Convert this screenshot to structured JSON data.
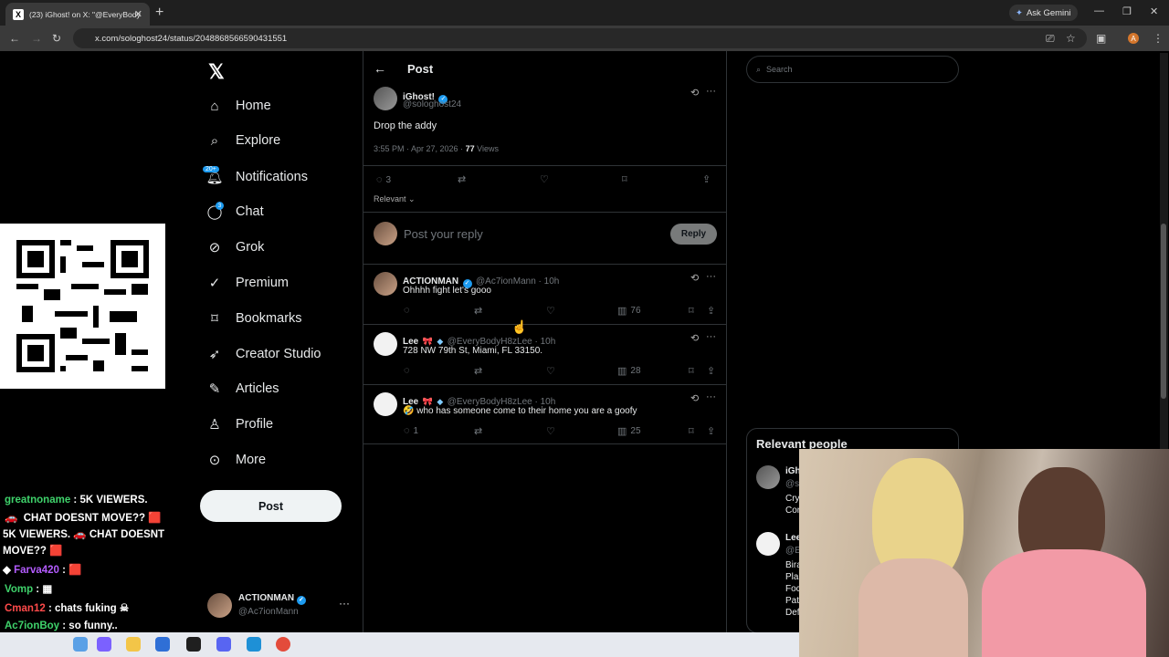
{
  "browser": {
    "tab_title": "(23) iGhost! on X: \"@EveryBody",
    "url": "x.com/sologhost24/status/2048868566590431551",
    "ask_gemini": "Ask Gemini",
    "profile_initial": "A"
  },
  "sidebar": {
    "items": [
      {
        "label": "Home",
        "icon": "home-icon"
      },
      {
        "label": "Explore",
        "icon": "search-icon"
      },
      {
        "label": "Notifications",
        "icon": "bell-icon"
      },
      {
        "label": "Chat",
        "icon": "chat-icon"
      },
      {
        "label": "Grok",
        "icon": "grok-icon"
      },
      {
        "label": "Premium",
        "icon": "premium-icon"
      },
      {
        "label": "Bookmarks",
        "icon": "bookmark-icon"
      },
      {
        "label": "Creator Studio",
        "icon": "rocket-icon"
      },
      {
        "label": "Articles",
        "icon": "articles-icon"
      },
      {
        "label": "Profile",
        "icon": "person-icon"
      },
      {
        "label": "More",
        "icon": "more-icon"
      }
    ],
    "notifications_badge": "20+",
    "chat_badge": "3",
    "post_button": "Post",
    "account": {
      "name": "ACTIONMAN",
      "handle": "@Ac7ionMann"
    }
  },
  "main": {
    "header_title": "Post",
    "post": {
      "author": "iGhost!",
      "handle": "@sologhost24",
      "text": "Drop the addy",
      "time": "3:55 PM · Apr 27, 2026 ·",
      "views_count": "77",
      "views_label": "Views",
      "reply_count": "3"
    },
    "sort_label": "Relevant",
    "reply_placeholder": "Post your reply",
    "reply_button": "Reply",
    "replies": [
      {
        "name": "ACTIONMAN",
        "handle": "@Ac7ionMann · 10h",
        "text": "Ohhhh fight let's gooo",
        "replies": "",
        "views": "76"
      },
      {
        "name": "Lee",
        "handle": "@EveryBodyH8zLee · 10h",
        "text": "728 NW 79th St, Miami, FL 33150.",
        "replies": "",
        "views": "28"
      },
      {
        "name": "Lee",
        "handle": "@EveryBodyH8zLee · 10h",
        "text": "🤣 who has someone come to their home you are a goofy",
        "replies": "1",
        "views": "25"
      }
    ]
  },
  "right": {
    "search_placeholder": "Search",
    "relevant_title": "Relevant people",
    "people_fragments": [
      "iGh",
      "@s",
      "Cry",
      "Cor",
      "Lee",
      "@E",
      "Bira",
      "Pla",
      "Foc",
      "Pat",
      "Def"
    ]
  },
  "stream_chat": [
    {
      "user": "greatnoname",
      "text": ": 5K VIEWERS.",
      "color": "#3fd26b"
    },
    {
      "user": "",
      "text": "CHAT DOESNT MOVE??",
      "color": "#ffffff"
    },
    {
      "user": "",
      "text": "5K VIEWERS.",
      "color": "#ffffff"
    },
    {
      "user": "",
      "text": "CHAT DOESNT",
      "color": "#ffffff"
    },
    {
      "user": "",
      "text": "MOVE??",
      "color": "#ffffff"
    },
    {
      "user": "Farva420",
      "text": ":",
      "color": "#b45cff"
    },
    {
      "user": "Vomp",
      "text": ":",
      "color": "#3fd26b"
    },
    {
      "user": "Cman12",
      "text": ": chats fuking",
      "color": "#ff4a4a"
    },
    {
      "user": "Ac7ionBoy",
      "text": ": so funny..",
      "color": "#3fd26b"
    }
  ]
}
